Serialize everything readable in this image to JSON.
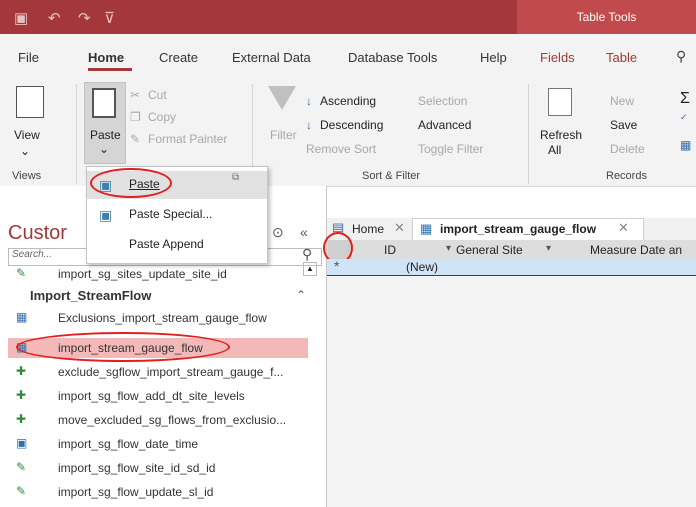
{
  "titlebar": {
    "context_tab": "Table Tools"
  },
  "ribbon_tabs": [
    "File",
    "Home",
    "Create",
    "External Data",
    "Database Tools",
    "Help",
    "Fields",
    "Table"
  ],
  "ribbon": {
    "views": {
      "view_label": "View",
      "group": "Views"
    },
    "clipboard": {
      "paste_label": "Paste",
      "cut": "Cut",
      "copy": "Copy",
      "format_painter": "Format Painter"
    },
    "sort_filter": {
      "filter": "Filter",
      "ascending": "Ascending",
      "descending": "Descending",
      "remove_sort": "Remove Sort",
      "selection": "Selection",
      "advanced": "Advanced",
      "toggle_filter": "Toggle Filter",
      "group": "Sort & Filter"
    },
    "records": {
      "refresh": "Refresh",
      "refresh_all": "All",
      "new": "New",
      "save": "Save",
      "delete": "Delete",
      "group": "Records"
    }
  },
  "paste_menu": {
    "paste": "Paste",
    "paste_special": "Paste Special...",
    "paste_append": "Paste Append"
  },
  "nav": {
    "title": "Custor",
    "search_placeholder": "Search...",
    "group_header": "Import_StreamFlow",
    "items": [
      "import_sg_sites_update_site_id",
      "Exclusions_import_stream_gauge_flow",
      "import_stream_gauge_flow",
      "exclude_sgflow_import_stream_gauge_f...",
      "import_sg_flow_add_dt_site_levels",
      "move_excluded_sg_flows_from_exclusio...",
      "import_sg_flow_date_time",
      "import_sg_flow_site_id_sd_id",
      "import_sg_flow_update_sl_id"
    ]
  },
  "doc_tabs": {
    "home": "Home",
    "active": "import_stream_gauge_flow"
  },
  "grid": {
    "col_id": "ID",
    "col_site": "General Site",
    "col_date": "Measure Date an",
    "new_row": "(New)"
  },
  "colors": {
    "accent": "#a4373a",
    "selection": "#f3b9b9",
    "annotation": "#e02020"
  }
}
